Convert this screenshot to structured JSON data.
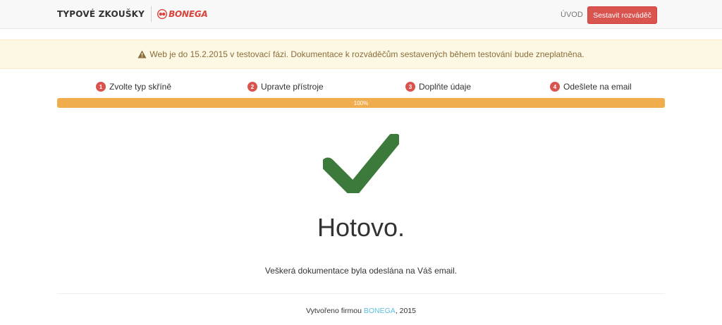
{
  "navbar": {
    "brand_text": "TYPOVÉ ZKOUŠKY",
    "logo_text": "BONEGA",
    "home_link": "ÚVOD",
    "cta_button": "Sestavit rozváděč"
  },
  "alert": {
    "icon": "warning-icon",
    "text": "Web je do 15.2.2015 v testovací fázi. Dokumentace k rozváděčům sestavených během testování bude zneplatněna."
  },
  "steps": [
    {
      "num": "1",
      "label": "Zvolte typ skříně"
    },
    {
      "num": "2",
      "label": "Upravte přístroje"
    },
    {
      "num": "3",
      "label": "Doplňte údaje"
    },
    {
      "num": "4",
      "label": "Odešlete na email"
    }
  ],
  "progress": {
    "value": 100,
    "label": "100%"
  },
  "result": {
    "icon": "checkmark-icon",
    "title": "Hotovo.",
    "message": "Veškerá dokumentace byla odeslána na Váš email."
  },
  "footer": {
    "prefix": "Vytvořeno firmou ",
    "link_text": "BONEGA",
    "suffix": ", 2015"
  },
  "colors": {
    "accent_red": "#d9534f",
    "progress_orange": "#f0ad4e",
    "check_green": "#3c7a3c",
    "warning_text": "#8a6d3b",
    "warning_bg": "#fcf8e3",
    "link_blue": "#5bc0de"
  }
}
